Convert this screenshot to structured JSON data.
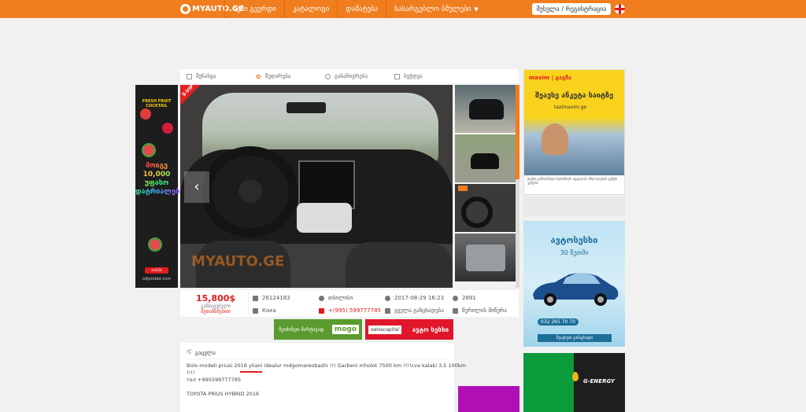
{
  "header": {
    "logo": "MYAUTO.GE",
    "nav": [
      "ჩემი გვერდი",
      "კატალოგი",
      "დამატება",
      "სასარგებლო ბმულები"
    ],
    "login": "შესვლა / რეგისტრაცია"
  },
  "actions": [
    "შენახვა",
    "შედარება",
    "გასაჩივრება",
    "ბეჭდვა"
  ],
  "photo": {
    "badge": "S-VIP",
    "watermark": "MYAUTO.GE",
    "prev": "‹"
  },
  "listing": {
    "price": "15,800$",
    "price_note1": "განბაჟებული",
    "price_note2": "შეთანხმებით",
    "id": "26124183",
    "location": "თბილისი",
    "date": "2017-08-29 16:23",
    "views": "2891",
    "seller": "Кaxa",
    "phone": "+(995) 599777785",
    "callback": "ყველა განცხადება",
    "message": "წერილის მიწერა"
  },
  "banners": {
    "mogo_text": "შეიძინეთ მარტივად",
    "mogo_brand": "mogo",
    "swiss_brand": "swisscapital",
    "swiss_text": "ავტო სესხი"
  },
  "description": {
    "header": "გაცვლა",
    "line1": "Bolo modeli priusi 2016 yliani idealur mdgomareobashi !!! Garbeni mholot 7500 km !!!!cva kalaki 3,5 100km",
    "line2": "!!!!",
    "line3": "тел +995599777785",
    "line4": "TOYOTA PRIUS HYBRID 2016"
  },
  "ads": {
    "left_brand": "FRESH FRUIT COCKTAIL",
    "left_headline": "მოიგე 10,000 უფასო დატრიალება!",
    "left_button": "თამაში",
    "left_url": "odjorobet.com",
    "maxim_brand": "maxim | გაგზა",
    "maxim_headline": "შეავსე ანკეტა საიტზე",
    "maxim_url": "taximaxim.ge",
    "maxim_text": "ტაქსი გამოიძახეთ ნებისმიერ ადგილას. მძღოლების გუნდს ვეძებთ.",
    "auto_headline": "ავტოსესხი",
    "auto_sub": "30 წუთში",
    "auto_phone": "032 265 70 70",
    "auto_button": "შეავსეთ განაცხადი",
    "genergy": "G-ENERGY"
  },
  "colors": {
    "accent": "#f07d1e",
    "price": "#e01c1c"
  }
}
